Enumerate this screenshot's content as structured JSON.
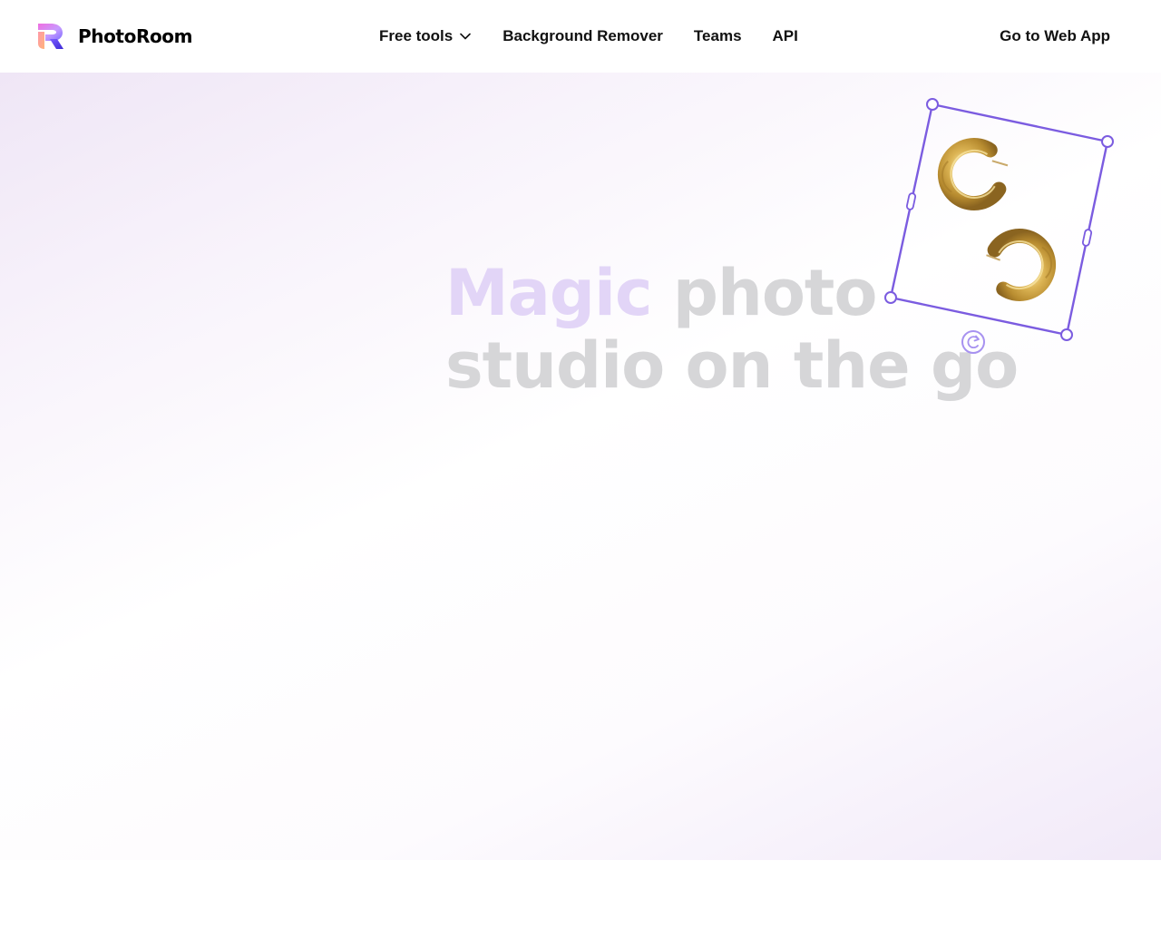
{
  "header": {
    "brand": "PhotoRoom",
    "nav": [
      {
        "label": "Free tools",
        "icon": "chevron-down-icon"
      },
      {
        "label": "Background Remover"
      },
      {
        "label": "Teams"
      },
      {
        "label": "API"
      }
    ],
    "cta_label": "Go to Web App"
  },
  "hero": {
    "headline": {
      "highlight": "Magic",
      "rest_line1": "photo",
      "line2": "studio on the go"
    },
    "editor_icons": [
      "resize-handle-icon",
      "rotate-icon"
    ]
  },
  "colors": {
    "accent": "#7b5ce0",
    "headline_gray": "#d6d6d8",
    "headline_highlight": "#e2d5f7",
    "hero_gradient_tint": "#efe6f6"
  }
}
